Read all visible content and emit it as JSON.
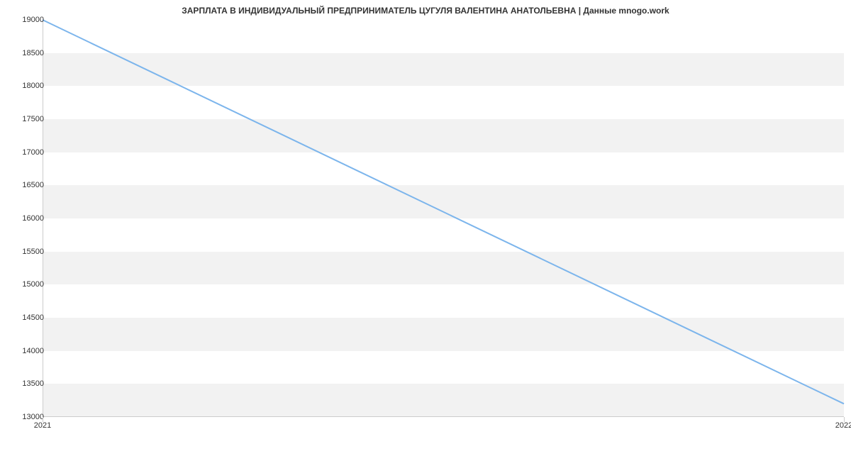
{
  "chart_data": {
    "type": "line",
    "title": "ЗАРПЛАТА В ИНДИВИДУАЛЬНЫЙ ПРЕДПРИНИМАТЕЛЬ ЦУГУЛЯ ВАЛЕНТИНА АНАТОЛЬЕВНА | Данные mnogo.work",
    "x": [
      2021,
      2022
    ],
    "values": [
      19000,
      13200
    ],
    "xlabel": "",
    "ylabel": "",
    "xlim": [
      2021,
      2022
    ],
    "ylim": [
      13000,
      19000
    ],
    "x_ticks": [
      2021,
      2022
    ],
    "y_ticks": [
      13000,
      13500,
      14000,
      14500,
      15000,
      15500,
      16000,
      16500,
      17000,
      17500,
      18000,
      18500,
      19000
    ],
    "line_color": "#7cb5ec"
  }
}
